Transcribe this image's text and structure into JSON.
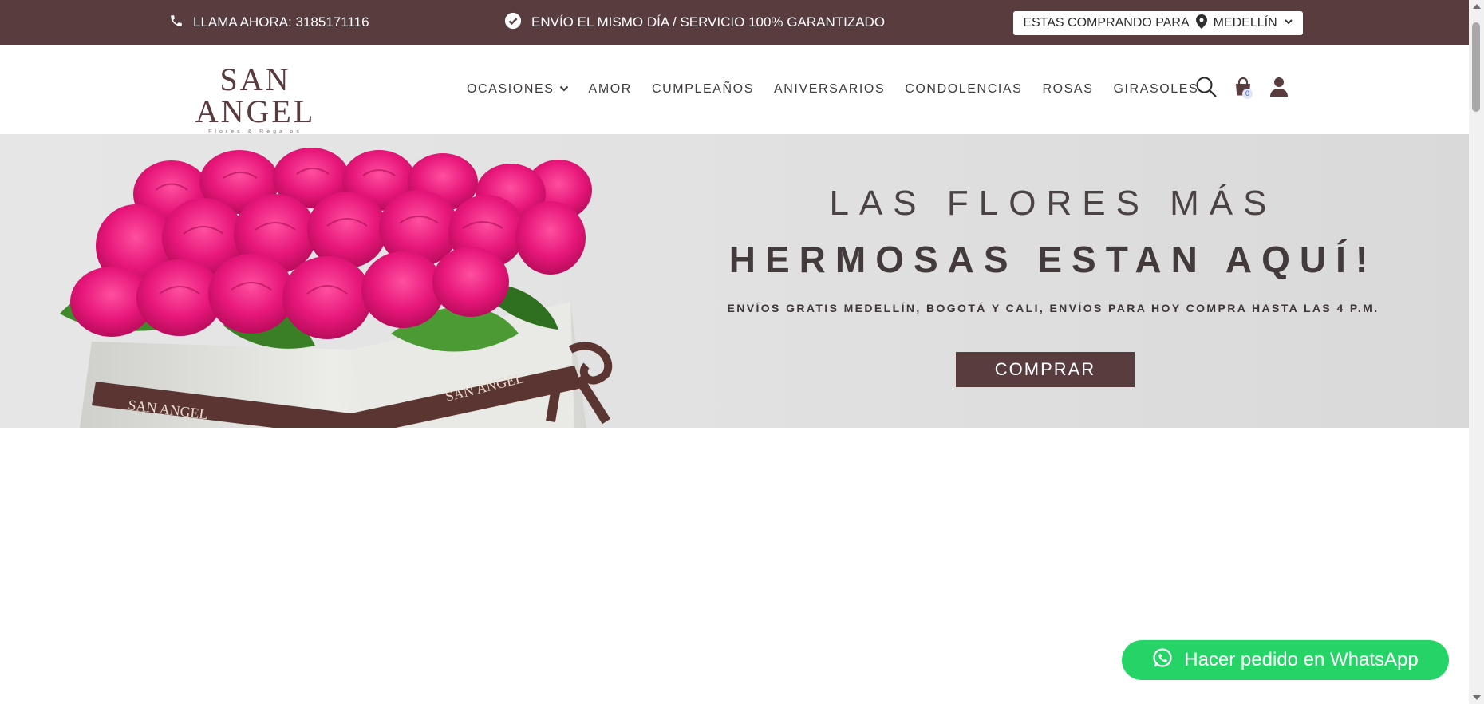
{
  "topbar": {
    "phone_text": "LLAMA AHORA: 3185171116",
    "shipping_text": "ENVÍO EL MISMO DÍA / SERVICIO 100% GARANTIZADO",
    "city_prefix": "ESTAS COMPRANDO PARA",
    "city": "MEDELLÍN",
    "background_color": "#583c3e"
  },
  "header": {
    "logo_name": "SAN ANGEL",
    "logo_tagline": "Flores & Regalos",
    "nav": [
      {
        "label": "OCASIONES",
        "has_dropdown": true
      },
      {
        "label": "AMOR"
      },
      {
        "label": "CUMPLEAÑOS"
      },
      {
        "label": "ANIVERSARIOS"
      },
      {
        "label": "CONDOLENCIAS"
      },
      {
        "label": "ROSAS"
      },
      {
        "label": "GIRASOLES"
      }
    ],
    "icons": [
      "search-icon",
      "shopping-bag-icon",
      "user-icon"
    ],
    "cart_count": "0"
  },
  "hero": {
    "headline_line1": "LAS FLORES MÁS",
    "headline_line2": "HERMOSAS ESTAN AQUÍ!",
    "subtext": "ENVÍOS GRATIS MEDELLÍN, BOGOTÁ Y CALI, ENVÍOS PARA HOY COMPRA HASTA LAS 4 P.M.",
    "cta_label": "COMPRAR",
    "ribbon_text": "SAN ANGEL",
    "ribbon_tagline": "Flores & Regalos"
  },
  "whatsapp": {
    "label": "Hacer pedido en WhatsApp",
    "color": "#25d366"
  }
}
